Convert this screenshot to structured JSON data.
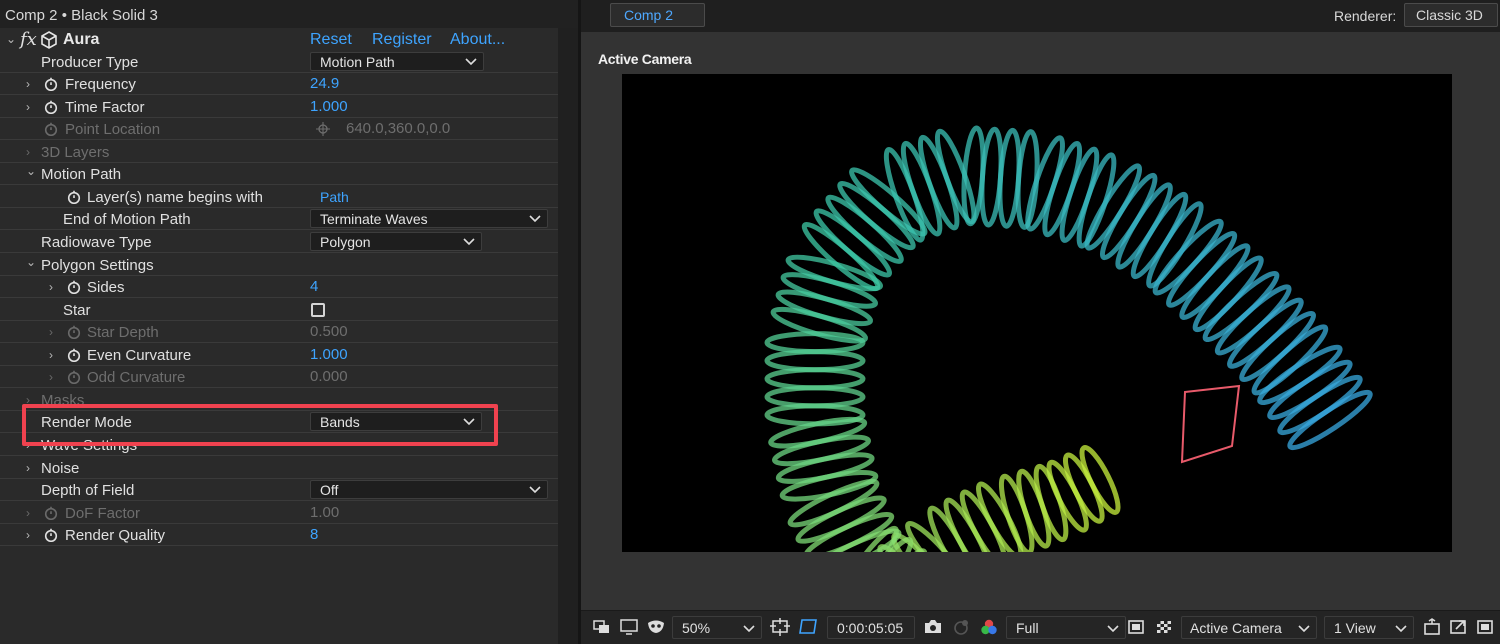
{
  "panel": {
    "title": "Comp 2 • Black Solid 3",
    "effect": {
      "fx_symbol": "fx",
      "name": "Aura",
      "links": {
        "reset": "Reset",
        "register": "Register",
        "about": "About..."
      }
    },
    "params": {
      "producer_type": {
        "label": "Producer Type",
        "value": "Motion Path"
      },
      "frequency": {
        "label": "Frequency",
        "value": "24.9"
      },
      "time_factor": {
        "label": "Time Factor",
        "value": "1.000"
      },
      "point_location": {
        "label": "Point Location",
        "value": "640.0,360.0,0.0"
      },
      "layers_3d": {
        "label": "3D Layers"
      },
      "motion_path": {
        "label": "Motion Path"
      },
      "layer_name": {
        "label": "Layer(s) name begins with",
        "value": "Path"
      },
      "end_of_motion_path": {
        "label": "End of Motion Path",
        "value": "Terminate Waves"
      },
      "radiowave_type": {
        "label": "Radiowave Type",
        "value": "Polygon"
      },
      "polygon_settings": {
        "label": "Polygon Settings"
      },
      "sides": {
        "label": "Sides",
        "value": "4"
      },
      "star": {
        "label": "Star",
        "checked": false
      },
      "star_depth": {
        "label": "Star Depth",
        "value": "0.500"
      },
      "even_curvature": {
        "label": "Even Curvature",
        "value": "1.000"
      },
      "odd_curvature": {
        "label": "Odd Curvature",
        "value": "0.000"
      },
      "masks": {
        "label": "Masks"
      },
      "render_mode": {
        "label": "Render Mode",
        "value": "Bands"
      },
      "wave_settings": {
        "label": "Wave Settings"
      },
      "noise": {
        "label": "Noise"
      },
      "depth_of_field": {
        "label": "Depth of Field",
        "value": "Off"
      },
      "dof_factor": {
        "label": "DoF Factor",
        "value": "1.00"
      },
      "render_quality": {
        "label": "Render Quality",
        "value": "8"
      }
    }
  },
  "viewer": {
    "tab": "Comp 2",
    "renderer_label": "Renderer:",
    "renderer_value": "Classic 3D",
    "camera_label": "Active Camera",
    "bottom": {
      "zoom": "50%",
      "timecode": "0:00:05:05",
      "resolution": "Full",
      "camera": "Active Camera",
      "views": "1 View"
    }
  },
  "colors": {
    "accent_blue": "#3ea4ff",
    "highlight_red": "#f0424f",
    "band_start": "#c8f03c",
    "band_mid": "#3cc8a8",
    "band_end": "#38a8e0"
  }
}
